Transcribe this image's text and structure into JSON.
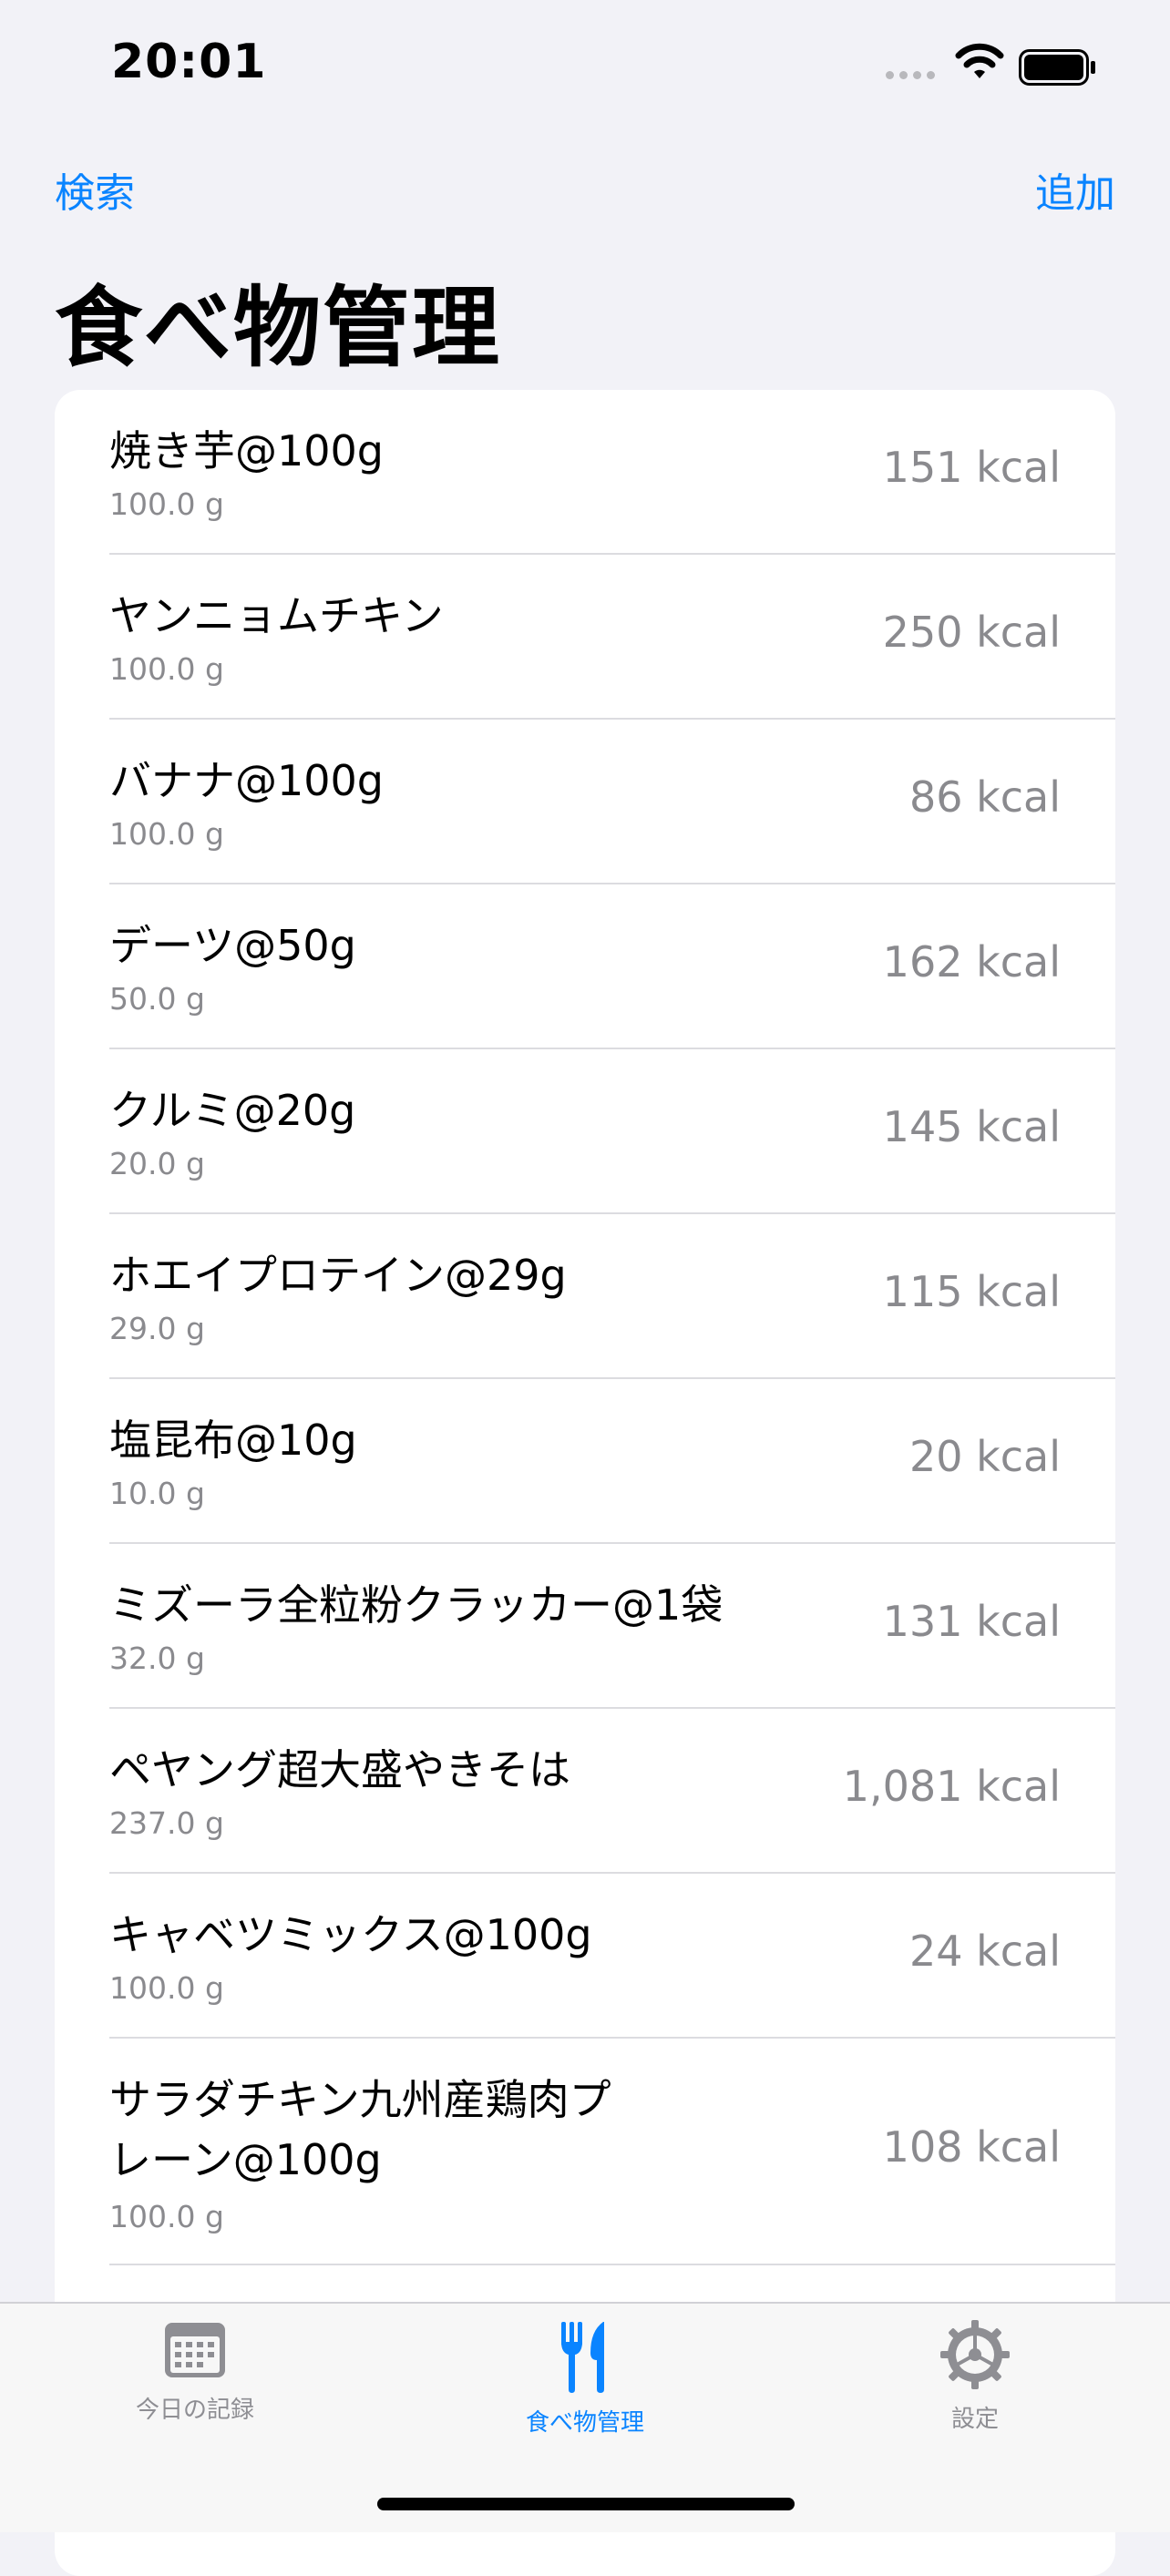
{
  "status": {
    "time": "20:01"
  },
  "nav": {
    "search": "検索",
    "add": "追加",
    "title": "食べ物管理"
  },
  "foods": [
    {
      "name": "焼き芋@100g",
      "weight": "100.0 g",
      "kcal": "151 kcal"
    },
    {
      "name": "ヤンニョムチキン",
      "weight": "100.0 g",
      "kcal": "250 kcal"
    },
    {
      "name": "バナナ@100g",
      "weight": "100.0 g",
      "kcal": "86 kcal"
    },
    {
      "name": "デーツ@50g",
      "weight": "50.0 g",
      "kcal": "162 kcal"
    },
    {
      "name": "クルミ@20g",
      "weight": "20.0 g",
      "kcal": "145 kcal"
    },
    {
      "name": "ホエイプロテイン@29g",
      "weight": "29.0 g",
      "kcal": "115 kcal"
    },
    {
      "name": "塩昆布@10g",
      "weight": "10.0 g",
      "kcal": "20 kcal"
    },
    {
      "name": "ミズーラ全粒粉クラッカー@1袋",
      "weight": "32.0 g",
      "kcal": "131 kcal"
    },
    {
      "name": "ペヤング超大盛やきそは",
      "weight": "237.0 g",
      "kcal": "1,081 kcal"
    },
    {
      "name": "キャベツミックス@100g",
      "weight": "100.0 g",
      "kcal": "24 kcal"
    },
    {
      "name": "サラダチキン九州産鶏肉プレーン@100g",
      "weight": "100.0 g",
      "kcal": "108 kcal"
    }
  ],
  "tabs": [
    {
      "label": "今日の記録",
      "icon": "calendar-icon"
    },
    {
      "label": "食べ物管理",
      "icon": "fork-knife-icon"
    },
    {
      "label": "設定",
      "icon": "gear-icon"
    }
  ],
  "colors": {
    "accent": "#0a84ff",
    "secondary_text": "#8a8a8e",
    "background": "#f2f2f7"
  }
}
